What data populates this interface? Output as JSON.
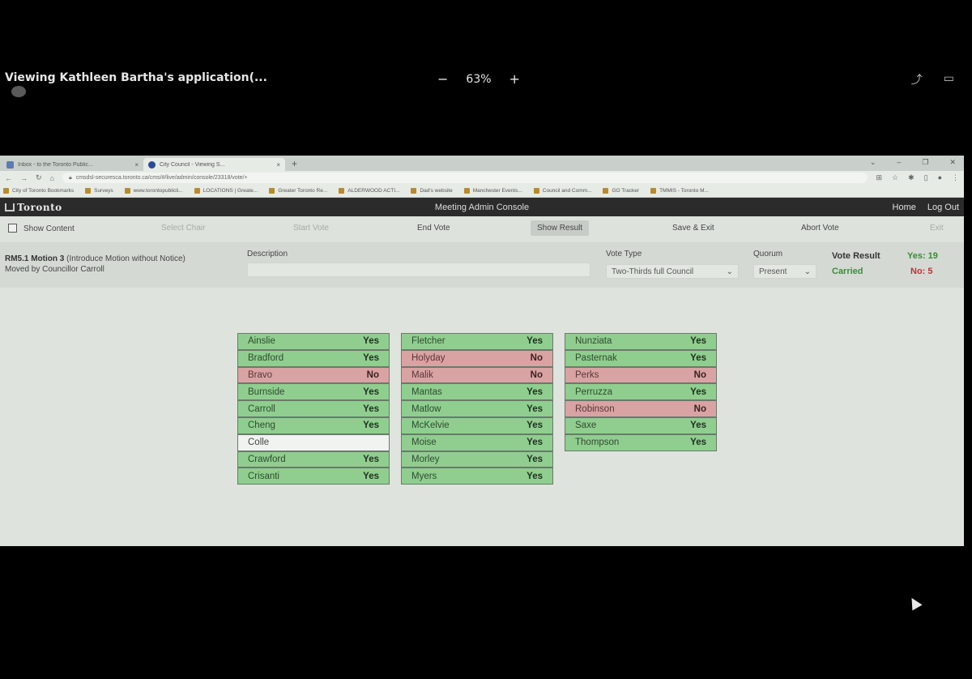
{
  "share": {
    "title": "Viewing Kathleen Bartha's application(...",
    "zoom": "63%",
    "zoom_out": "−",
    "zoom_in": "+"
  },
  "browser": {
    "tabs": [
      {
        "label": "Inbox - to the Toronto Public...",
        "close": "×"
      },
      {
        "label": "City Council - Viewing S...",
        "close": "×"
      }
    ],
    "new_tab": "+",
    "url": "cmsdsl-securesca.toronto.ca/cms/#/live/admin/console/23318/vote/+",
    "bookmarks": [
      "City of Toronto Bookmarks",
      "Surveys",
      "www.torontopublicli...",
      "LOCATIONS | Greate...",
      "Greater Toronto Re...",
      "ALDERWOOD ACTI...",
      "Dad's website",
      "Manchester Events...",
      "Council and Comm...",
      "GO Tracker",
      "TMMIS - Toronto M..."
    ]
  },
  "app": {
    "logo": "Toronto",
    "title": "Meeting Admin Console",
    "home": "Home",
    "logout": "Log Out"
  },
  "toolbar": {
    "show_content": "Show Content",
    "select_chair": "Select Chair",
    "start_vote": "Start Vote",
    "end_vote": "End Vote",
    "show_result": "Show Result",
    "save_exit": "Save & Exit",
    "abort_vote": "Abort Vote",
    "exit": "Exit"
  },
  "motion": {
    "code": "RM5.1 Motion 3",
    "desc_inline": "(Introduce Motion without Notice)",
    "moved_by": "Moved by Councillor Carroll",
    "description_label": "Description",
    "description_value": "",
    "vote_type_label": "Vote Type",
    "vote_type_value": "Two-Thirds full Council",
    "quorum_label": "Quorum",
    "quorum_value": "Present",
    "vote_result_label": "Vote Result",
    "vote_result_value": "Carried",
    "yes_count": "Yes: 19",
    "no_count": "No: 5"
  },
  "votes": {
    "columns": [
      [
        {
          "name": "Ainslie",
          "vote": "Yes"
        },
        {
          "name": "Bradford",
          "vote": "Yes"
        },
        {
          "name": "Bravo",
          "vote": "No"
        },
        {
          "name": "Burnside",
          "vote": "Yes"
        },
        {
          "name": "Carroll",
          "vote": "Yes"
        },
        {
          "name": "Cheng",
          "vote": "Yes"
        },
        {
          "name": "Colle",
          "vote": ""
        },
        {
          "name": "Crawford",
          "vote": "Yes"
        },
        {
          "name": "Crisanti",
          "vote": "Yes"
        }
      ],
      [
        {
          "name": "Fletcher",
          "vote": "Yes"
        },
        {
          "name": "Holyday",
          "vote": "No"
        },
        {
          "name": "Malik",
          "vote": "No"
        },
        {
          "name": "Mantas",
          "vote": "Yes"
        },
        {
          "name": "Matlow",
          "vote": "Yes"
        },
        {
          "name": "McKelvie",
          "vote": "Yes"
        },
        {
          "name": "Moise",
          "vote": "Yes"
        },
        {
          "name": "Morley",
          "vote": "Yes"
        },
        {
          "name": "Myers",
          "vote": "Yes"
        }
      ],
      [
        {
          "name": "Nunziata",
          "vote": "Yes"
        },
        {
          "name": "Pasternak",
          "vote": "Yes"
        },
        {
          "name": "Perks",
          "vote": "No"
        },
        {
          "name": "Perruzza",
          "vote": "Yes"
        },
        {
          "name": "Robinson",
          "vote": "No"
        },
        {
          "name": "Saxe",
          "vote": "Yes"
        },
        {
          "name": "Thompson",
          "vote": "Yes"
        }
      ]
    ]
  },
  "colors": {
    "yes": "#8fce8f",
    "no": "#d9a3a3",
    "abstain": "#f1f3f1",
    "carried": "#3e8a3a",
    "no_count": "#c43030"
  }
}
